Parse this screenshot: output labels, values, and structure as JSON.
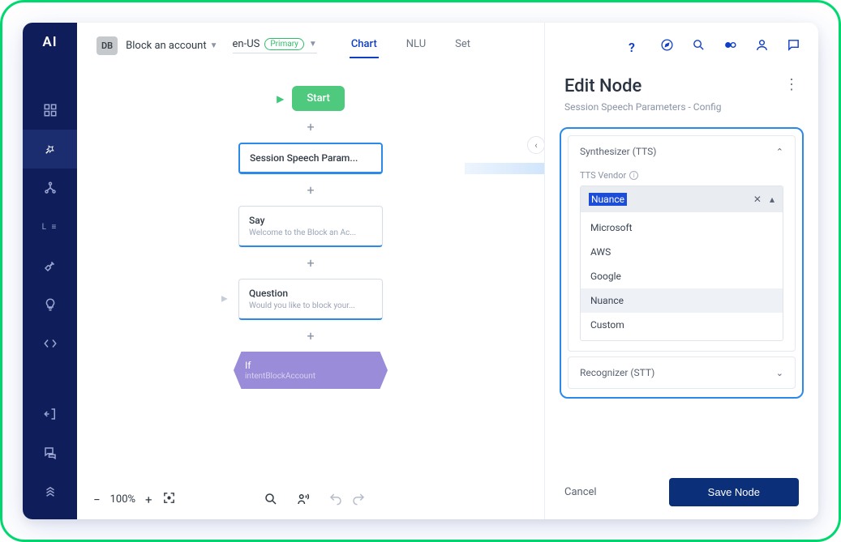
{
  "logo": "AI",
  "breadcrumb": {
    "badge": "DB",
    "title": "Block an account",
    "locale": "en-US",
    "locale_badge": "Primary"
  },
  "tabs": [
    {
      "label": "Chart",
      "active": true
    },
    {
      "label": "NLU",
      "active": false
    },
    {
      "label": "Set",
      "active": false
    }
  ],
  "flow": {
    "start": "Start",
    "nodes": [
      {
        "title": "Session Speech Param...",
        "sub": "",
        "selected": true
      },
      {
        "title": "Say",
        "sub": "Welcome to the Block an Ac..."
      },
      {
        "title": "Question",
        "sub": "Would you like to block your..."
      }
    ],
    "if_node": {
      "title": "If",
      "sub": "intentBlockAccount"
    }
  },
  "zoom": {
    "level": "100%"
  },
  "panel": {
    "title": "Edit Node",
    "subtitle": "Session Speech Parameters - Config",
    "sections": {
      "tts": {
        "label": "Synthesizer (TTS)",
        "field_label": "TTS Vendor",
        "value": "Nuance",
        "options": [
          "Microsoft",
          "AWS",
          "Google",
          "Nuance",
          "Custom"
        ]
      },
      "stt": {
        "label": "Recognizer (STT)"
      }
    },
    "cancel": "Cancel",
    "save": "Save Node"
  }
}
